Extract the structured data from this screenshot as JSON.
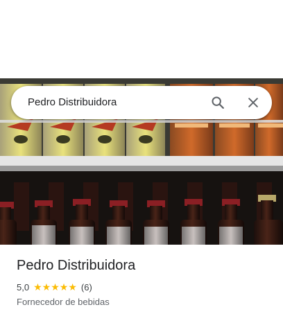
{
  "search": {
    "query": "Pedro Distribuidora",
    "search_icon": "search-icon",
    "close_icon": "close-icon"
  },
  "photo": {
    "subject": "beer-bottles-fridge-photo"
  },
  "place": {
    "title": "Pedro Distribuidora",
    "rating": "5,0",
    "stars": 5,
    "star_color": "#fbbc04",
    "review_count": "(6)",
    "category": "Fornecedor de bebidas"
  }
}
